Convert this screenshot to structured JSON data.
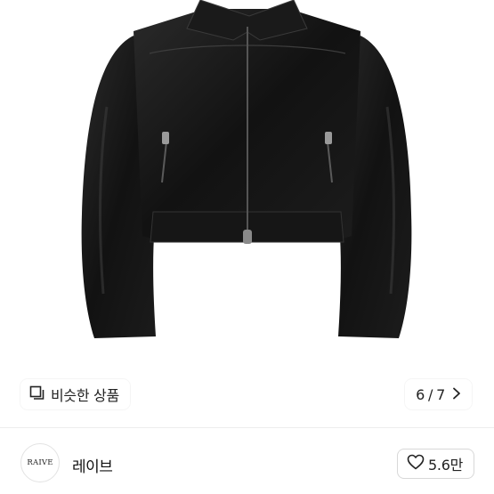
{
  "similar_button": {
    "label": "비슷한 상품",
    "icon": "similar-items-icon"
  },
  "gallery": {
    "current": "6",
    "separator": "/",
    "total": "7"
  },
  "seller": {
    "logo_text": "RAIVE",
    "name": "레이브"
  },
  "like_button": {
    "count": "5.6만",
    "icon": "heart-outline-icon"
  },
  "colors": {
    "leather": "#141414",
    "overlay_pill": "#ffffffeb",
    "divider": "#ededed"
  }
}
